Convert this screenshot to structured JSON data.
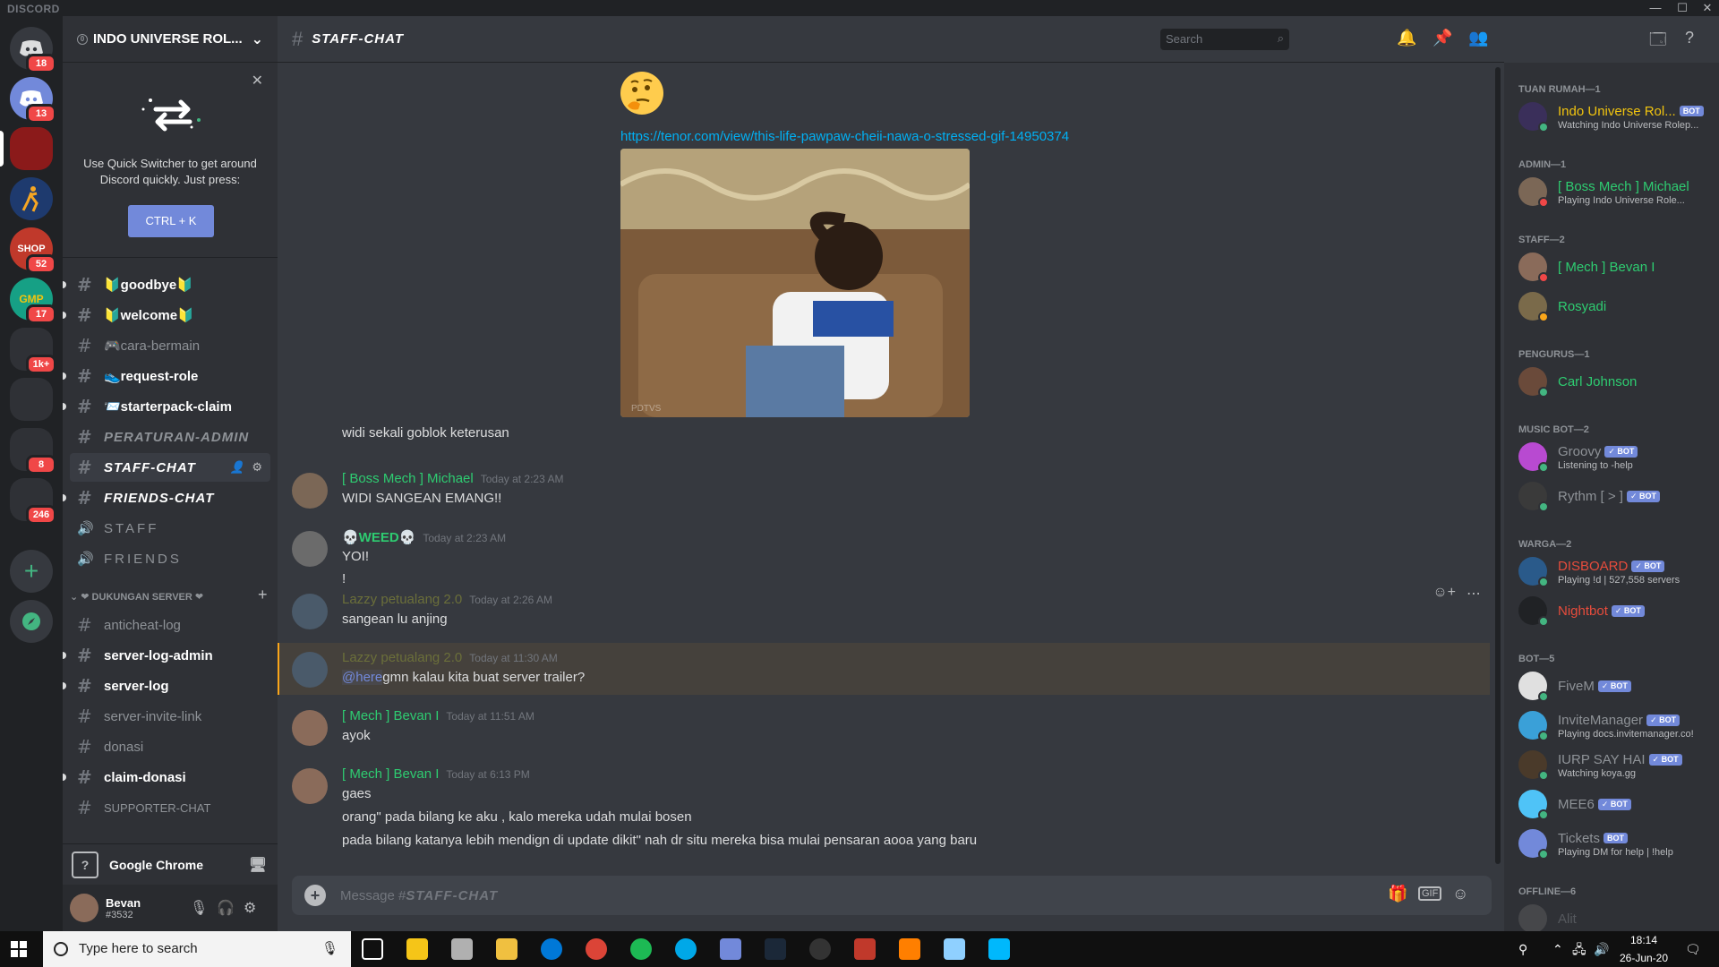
{
  "app": {
    "brand": "DISCORD"
  },
  "window_controls": {
    "minimize": "—",
    "maximize": "☐",
    "close": "✕"
  },
  "guild_badges": [
    "18",
    "13",
    "52",
    "17",
    "1k+",
    "8",
    "246"
  ],
  "server": {
    "name": "INDO UNIVERSE ROL...",
    "chevron": "⌄"
  },
  "quick_switcher": {
    "text": "Use Quick Switcher to get around Discord quickly. Just press:",
    "button": "CTRL + K",
    "close": "✕"
  },
  "channels": [
    {
      "name": "🔰goodbye🔰"
    },
    {
      "name": "🔰welcome🔰"
    },
    {
      "name": "🎮cara-bermain"
    },
    {
      "name": "👟request-role"
    },
    {
      "name": "📨starterpack-claim"
    },
    {
      "name": "PERATURAN-ADMIN"
    },
    {
      "name": "STAFF-CHAT"
    },
    {
      "name": "FRIENDS-CHAT"
    },
    {
      "name": "STAFF"
    },
    {
      "name": "FRIENDS"
    },
    {
      "name": "anticheat-log"
    },
    {
      "name": "server-log-admin"
    },
    {
      "name": "server-log"
    },
    {
      "name": "server-invite-link"
    },
    {
      "name": "donasi"
    },
    {
      "name": "claim-donasi"
    },
    {
      "name": "SUPPORTER-CHAT"
    }
  ],
  "category": {
    "name": "❤ DUKUNGAN SERVER ❤",
    "add": "+"
  },
  "activity": {
    "label": "Google Chrome"
  },
  "user": {
    "name": "Bevan",
    "tag": "#3532"
  },
  "chat": {
    "channel_title": "STAFF-CHAT",
    "search_placeholder": "Search",
    "composer_placeholder_prefix": "Message #",
    "composer_placeholder_channel": "STAFF-CHAT",
    "link": "https://tenor.com/view/this-life-pawpaw-cheii-nawa-o-stressed-gif-14950374",
    "gif_watermark": "PDTVS"
  },
  "messages": [
    {
      "author": "",
      "time": "",
      "lines": [
        "widi sekali goblok keterusan"
      ]
    },
    {
      "author": "[ Boss Mech ] Michael",
      "color": "#2ecc71",
      "time": "Today at 2:23 AM",
      "lines": [
        "WIDI SANGEAN EMANG!!"
      ]
    },
    {
      "author": "💀WEED💀",
      "color": "#2ecc71",
      "time": "Today at 2:23 AM",
      "lines": [
        "YOI!",
        "!"
      ]
    },
    {
      "author": "Lazzy petualang 2.0",
      "color": "#6b6f3a",
      "time": "Today at 2:26 AM",
      "lines": [
        "sangean lu anjing"
      ]
    },
    {
      "author": "Lazzy petualang 2.0",
      "color": "#6b6f3a",
      "time": "Today at 11:30 AM",
      "mention": "@here",
      "lines": [
        "gmn kalau kita buat server trailer?"
      ]
    },
    {
      "author": "[ Mech ] Bevan I",
      "color": "#2ecc71",
      "time": "Today at 11:51 AM",
      "lines": [
        "ayok"
      ]
    },
    {
      "author": "[ Mech ] Bevan I",
      "color": "#2ecc71",
      "time": "Today at 6:13 PM",
      "lines": [
        "gaes",
        "orang\" pada bilang ke aku , kalo mereka udah mulai bosen",
        "pada bilang katanya lebih mendign  di update dikit\" nah dr situ mereka bisa mulai pensaran aooa yang baru"
      ]
    }
  ],
  "members": {
    "roles": [
      "TUAN RUMAH—1",
      "ADMIN—1",
      "STAFF—2",
      "PENGURUS—1",
      "MUSIC BOT—2",
      "WARGA—2",
      "BOT—5",
      "OFFLINE—6"
    ],
    "list": [
      {
        "name": "Indo Universe Rol...",
        "color": "#f1c40f",
        "bot": "BOT",
        "activity": "Watching Indo Universe Rolep..."
      },
      {
        "name": "[ Boss Mech ] Michael",
        "color": "#2ecc71",
        "activity": "Playing Indo Universe Role..."
      },
      {
        "name": "[ Mech ] Bevan I",
        "color": "#2ecc71"
      },
      {
        "name": "Rosyadi",
        "color": "#2ecc71"
      },
      {
        "name": "Carl Johnson",
        "color": "#2ecc71"
      },
      {
        "name": "Groovy",
        "color": "#8e9297",
        "bot": "✓ BOT",
        "activity": "Listening to -help"
      },
      {
        "name": "Rythm [ > ]",
        "color": "#8e9297",
        "bot": "✓ BOT"
      },
      {
        "name": "DISBOARD",
        "color": "#e74c3c",
        "bot": "✓ BOT",
        "activity": "Playing !d | 527,558 servers"
      },
      {
        "name": "Nightbot",
        "color": "#e74c3c",
        "bot": "✓ BOT"
      },
      {
        "name": "FiveM",
        "color": "#8e9297",
        "bot": "✓ BOT"
      },
      {
        "name": "InviteManager",
        "color": "#8e9297",
        "bot": "✓ BOT",
        "activity": "Playing docs.invitemanager.co!"
      },
      {
        "name": "IURP SAY HAI",
        "color": "#8e9297",
        "bot": "✓ BOT",
        "activity": "Watching koya.gg"
      },
      {
        "name": "MEE6",
        "color": "#8e9297",
        "bot": "✓ BOT"
      },
      {
        "name": "Tickets",
        "color": "#8e9297",
        "bot": "BOT",
        "activity": "Playing DM for help | !help"
      },
      {
        "name": "Alit",
        "color": "#8e9297"
      }
    ]
  },
  "taskbar": {
    "search_placeholder": "Type here to search",
    "time": "18:14",
    "date": "26-Jun-20"
  },
  "colors": {
    "accent": "#7289da",
    "background": "#36393f",
    "sidebar": "#2f3136",
    "guilds": "#202225",
    "mention": "#f04747"
  }
}
